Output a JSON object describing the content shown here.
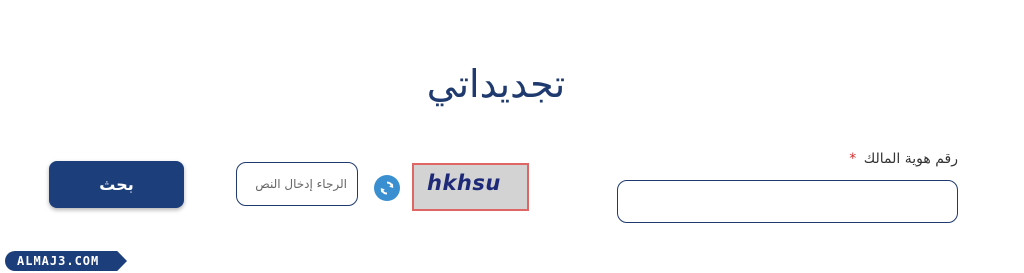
{
  "page": {
    "title": "تجديداتي"
  },
  "form": {
    "owner_id_label": "رقم هوية المالك",
    "required_marker": "*",
    "owner_id_value": "",
    "captcha_text": "hkhsu",
    "captcha_input_placeholder": "الرجاء إدخال النص",
    "refresh_icon": "refresh-icon",
    "search_button_label": "بحث"
  },
  "watermark": {
    "text": "ALMAJ3.COM"
  },
  "colors": {
    "primary": "#1c3f7c",
    "accent": "#3a8fd0",
    "captcha_border": "#e06666",
    "required": "#d32f2f"
  }
}
